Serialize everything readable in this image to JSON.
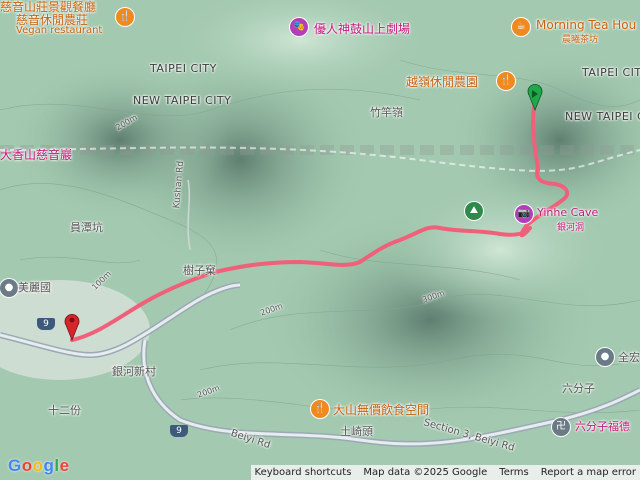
{
  "map": {
    "labels": {
      "vegan_restaurant_title_1": "慈音山莊景觀餐廳",
      "vegan_restaurant_title_2": "慈音休閒農莊",
      "vegan_restaurant_sub": "Vegan restaurant",
      "theater": "優人神鼓山上劇場",
      "morning_tea_en": "Morning Tea Hou",
      "morning_tea_zh": "晨曦茶坊",
      "taipei_city_1": "TAIPEI CITY",
      "taipei_city_2": "TAIPEI CITY",
      "new_taipei_1": "NEW TAIPEI CITY",
      "new_taipei_2": "NEW TAIPEI CITY",
      "yueling_farm": "越嶺休閒農園",
      "zhuganling": "竹竿嶺",
      "ciyin_temple": "大香山慈音巖",
      "kushan_rd": "Kushan Rd",
      "yuantankeng": "員潭坑",
      "yinhe_cave_en": "Yinhe Cave",
      "yinhe_cave_zh": "銀河洞",
      "zhuzike": "樹子窠",
      "meili": "美麗國",
      "yinhe_village": "銀河新村",
      "twelve_fen": "十二份",
      "contour_100": "100m",
      "contour_200a": "200m",
      "contour_200b": "200m",
      "contour_200c": "200m",
      "contour_300": "300m",
      "restaurant_dashan": "大山無價飲食空間",
      "beiyi_rd": "Beiyi Rd",
      "tuqitou": "土崎頭",
      "beiyi_section3": "Section 3, Beiyi Rd",
      "liufenzi_1": "六分子",
      "liufenzi_2": "六分子福德",
      "quanhong": "全宏",
      "route_9a": "9",
      "route_9b": "9"
    },
    "colors": {
      "track": "#f0607a",
      "start_marker": "#d6262b",
      "end_marker": "#1ea84a",
      "terrain": "#9fc7ad",
      "ridge_shadow": "#6e8f7e"
    },
    "icons": [
      "restaurant-icon",
      "theater-icon",
      "cafe-icon",
      "trailhead-icon",
      "cave-icon",
      "place-icon",
      "temple-icon"
    ],
    "footer": {
      "keyboard": "Keyboard shortcuts",
      "mapdata": "Map data ©2025 Google",
      "terms": "Terms",
      "report": "Report a map error"
    },
    "logo": "Google"
  }
}
